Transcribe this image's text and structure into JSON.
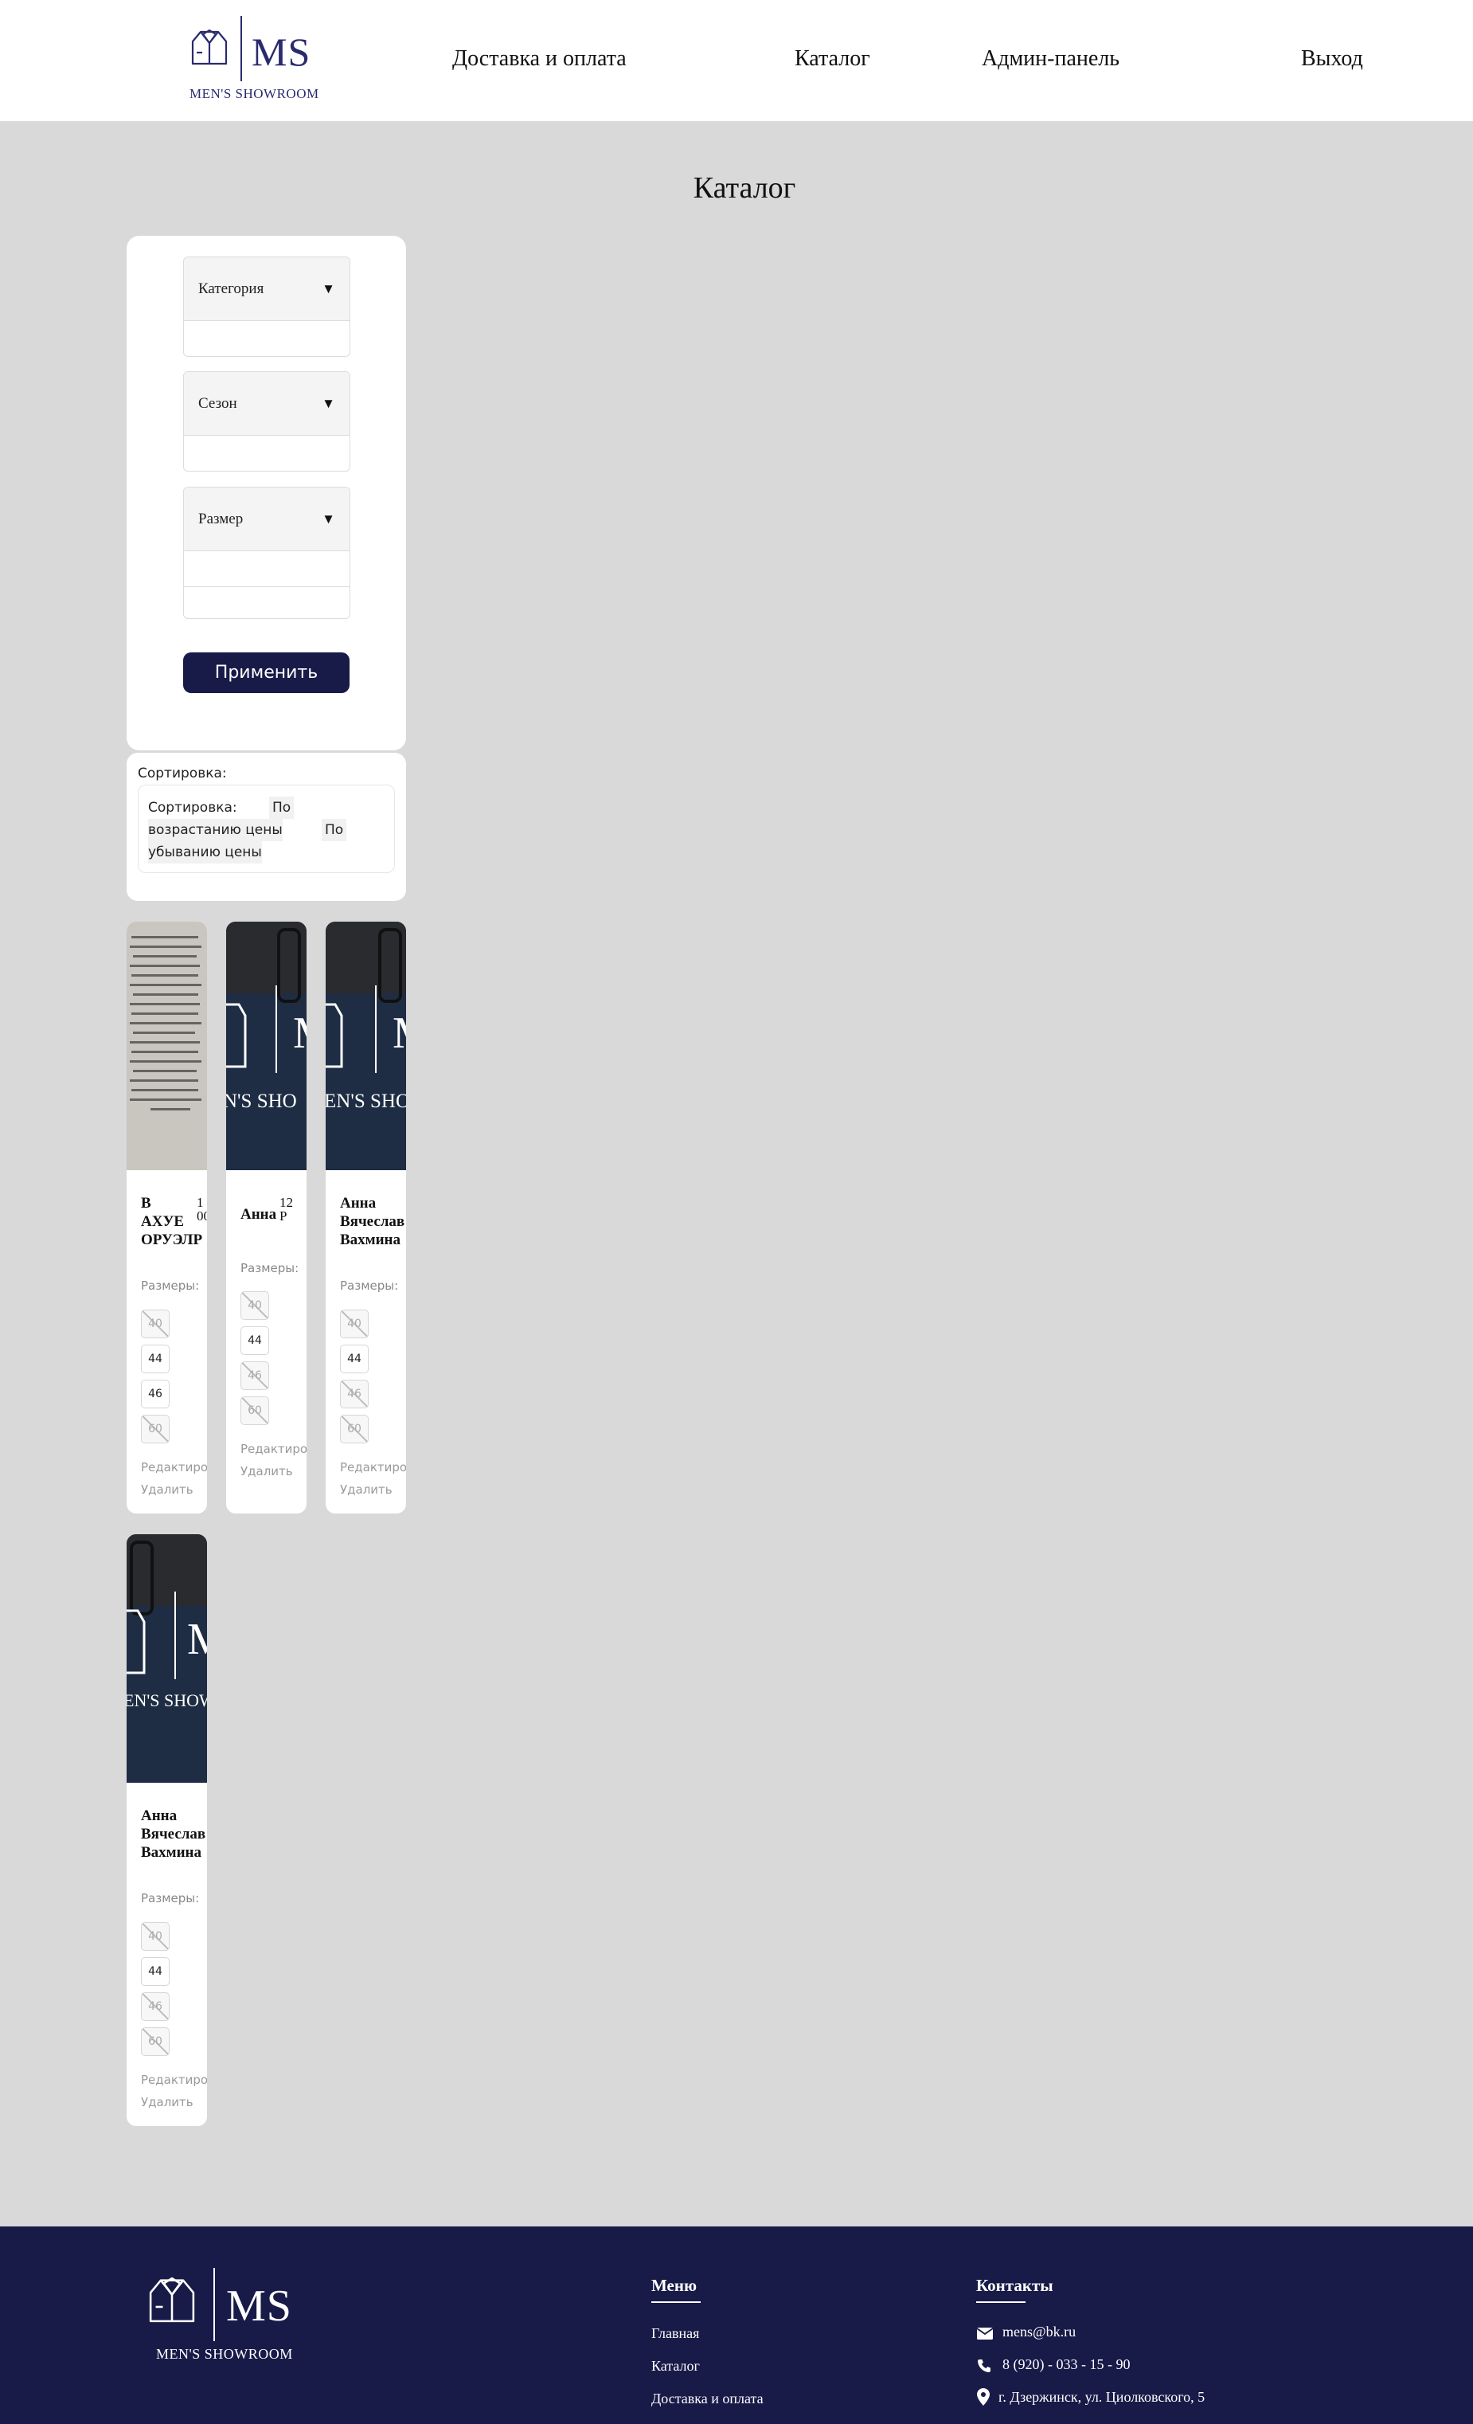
{
  "header": {
    "logo": {
      "mark": "MS",
      "subtitle": "MEN'S SHOWROOM"
    },
    "nav": [
      {
        "label": "Доставка и оплата"
      },
      {
        "label": "Каталог"
      },
      {
        "label": "Админ-панель"
      },
      {
        "label": "Выход"
      }
    ],
    "accent_color": "#2a2a6e"
  },
  "page": {
    "title": "Каталог"
  },
  "filters": {
    "category": {
      "label": "Категория",
      "arrow": "▼"
    },
    "season": {
      "label": "Сезон",
      "arrow": "▼"
    },
    "size": {
      "label": "Размер",
      "arrow": "▼"
    },
    "apply_label": "Применить",
    "button_color": "#181a48"
  },
  "sorting": {
    "title": "Сортировка:",
    "box_label": "Сортировка:",
    "asc_line1": "По",
    "asc_line2": "возрастанию цены",
    "desc_line1": "По",
    "desc_line2": "убыванию цены"
  },
  "products": [
    {
      "image": "document-photo",
      "name_lines": [
        "В",
        "АХУЕ",
        "ОРУЭЛР"
      ],
      "price_lines": [
        "1",
        "00"
      ],
      "sizes_label": "Размеры:",
      "sizes": [
        {
          "v": "40",
          "available": false
        },
        {
          "v": "44",
          "available": true
        },
        {
          "v": "46",
          "available": true
        },
        {
          "v": "60",
          "available": false
        }
      ],
      "edit": "Редактиро",
      "delete": "Удалить"
    },
    {
      "image": "jeans-logo",
      "image_text": "N'S SHO",
      "name_lines": [
        "Анна"
      ],
      "price_lines": [
        "12",
        "Р"
      ],
      "sizes_label": "Размеры:",
      "sizes": [
        {
          "v": "40",
          "available": false
        },
        {
          "v": "44",
          "available": true
        },
        {
          "v": "46",
          "available": false
        },
        {
          "v": "60",
          "available": false
        }
      ],
      "edit": "Редактиро",
      "delete": "Удалить"
    },
    {
      "image": "jeans-logo",
      "image_text": "EN'S SHO",
      "name_lines": [
        "Анна",
        "Вячеслав",
        "Вахмина"
      ],
      "price_lines": [],
      "sizes_label": "Размеры:",
      "sizes": [
        {
          "v": "40",
          "available": false
        },
        {
          "v": "44",
          "available": true
        },
        {
          "v": "46",
          "available": false
        },
        {
          "v": "60",
          "available": false
        }
      ],
      "edit": "Редактиро",
      "delete": "Удалить"
    },
    {
      "image": "jeans-logo",
      "image_text": "EN'S SHOW",
      "name_lines": [
        "Анна",
        "Вячеслав",
        "Вахмина"
      ],
      "price_lines": [],
      "sizes_label": "Размеры:",
      "sizes": [
        {
          "v": "40",
          "available": false
        },
        {
          "v": "44",
          "available": true
        },
        {
          "v": "46",
          "available": false
        },
        {
          "v": "60",
          "available": false
        }
      ],
      "edit": "Редактиро",
      "delete": "Удалить"
    }
  ],
  "footer": {
    "logo": {
      "mark": "MS",
      "subtitle": "MEN'S SHOWROOM"
    },
    "menu_title": "Меню",
    "menu": [
      {
        "label": "Главная"
      },
      {
        "label": "Каталог"
      },
      {
        "label": "Доставка и оплата"
      }
    ],
    "contacts_title": "Контакты",
    "email": "mens@bk.ru",
    "phone": "8 (920) - 033 - 15 - 90",
    "address": "г. Дзержинск, ул. Циолковского, 5",
    "background": "#181a48"
  }
}
